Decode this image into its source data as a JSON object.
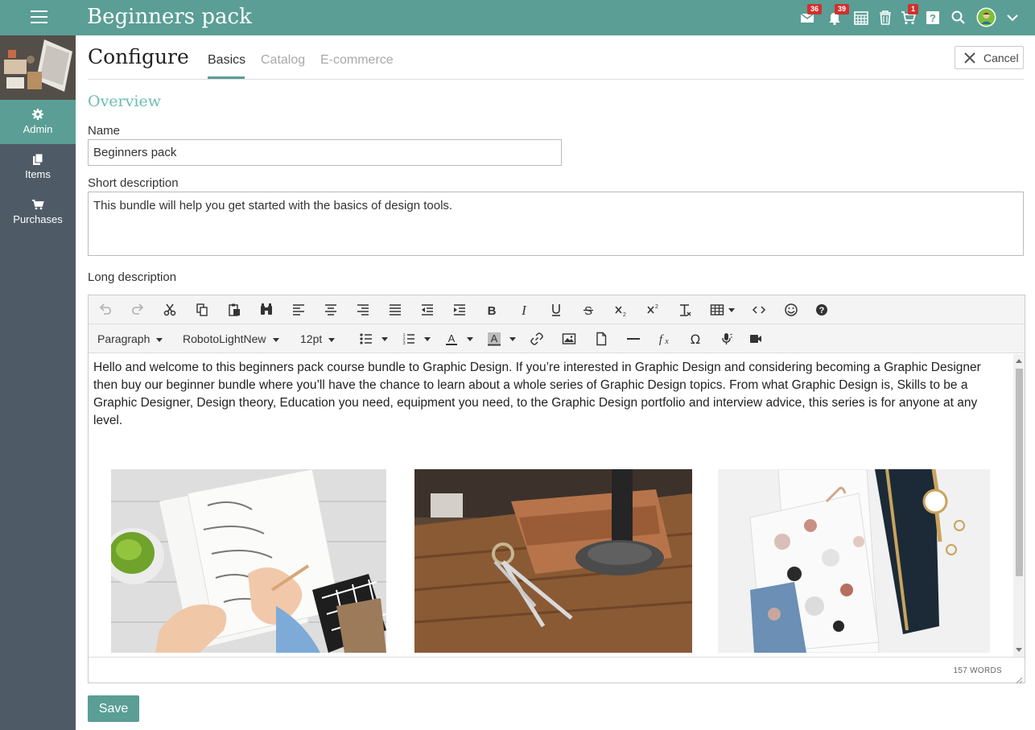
{
  "app": {
    "title": "Beginners pack"
  },
  "topbar": {
    "icons": [
      {
        "name": "messages-icon",
        "badge": "36"
      },
      {
        "name": "notifications-icon",
        "badge": "39"
      },
      {
        "name": "calendar-icon",
        "badge": ""
      },
      {
        "name": "trash-icon",
        "badge": ""
      },
      {
        "name": "cart-icon",
        "badge": "1"
      },
      {
        "name": "help-icon",
        "badge": ""
      },
      {
        "name": "search-icon",
        "badge": ""
      },
      {
        "name": "avatar",
        "badge": ""
      },
      {
        "name": "chevron-down-icon",
        "badge": ""
      }
    ]
  },
  "sidebar": {
    "items": [
      {
        "label": "Admin",
        "icon": "gear-icon",
        "active": true
      },
      {
        "label": "Items",
        "icon": "documents-icon",
        "active": false
      },
      {
        "label": "Purchases",
        "icon": "cart-icon",
        "active": false
      }
    ]
  },
  "header": {
    "title": "Configure",
    "tabs": [
      {
        "label": "Basics",
        "active": true
      },
      {
        "label": "Catalog",
        "active": false
      },
      {
        "label": "E-commerce",
        "active": false
      }
    ],
    "cancel_label": "Cancel"
  },
  "form": {
    "section_title": "Overview",
    "name_label": "Name",
    "name_value": "Beginners pack",
    "short_desc_label": "Short description",
    "short_desc_value": "This bundle will help you get started with the basics of design tools.",
    "long_desc_label": "Long description"
  },
  "editor": {
    "toolbar_row1": [
      "undo-icon",
      "redo-icon",
      "cut-icon",
      "copy-icon",
      "paste-icon",
      "find-icon",
      "align-left-icon",
      "align-center-icon",
      "align-right-icon",
      "align-justify-icon",
      "outdent-icon",
      "indent-icon",
      "bold-icon",
      "italic-icon",
      "underline-icon",
      "strikethrough-icon",
      "subscript-icon",
      "superscript-icon",
      "clear-format-icon",
      "table-icon",
      "source-code-icon",
      "emoji-icon",
      "help-icon"
    ],
    "block_format": "Paragraph",
    "font_family": "RobotoLightNew",
    "font_size": "12pt",
    "content_text": "Hello and welcome to this beginners pack course bundle to Graphic Design. If you’re interested in Graphic Design and considering becoming a Graphic Designer then buy our beginner bundle where you’ll have the chance to learn about a whole series of Graphic Design topics. From what Graphic Design is, Skills to be a Graphic Designer, Design theory, Education you need, equipment you need, to the Graphic Design portfolio and interview advice, this series is for anyone at any level.",
    "word_count": "157 WORDS"
  },
  "save_label": "Save",
  "colors": {
    "primary": "#5a9e95",
    "sidebar": "#4e5b66",
    "accent_title": "#6fbdb2",
    "badge": "#d0312d"
  }
}
